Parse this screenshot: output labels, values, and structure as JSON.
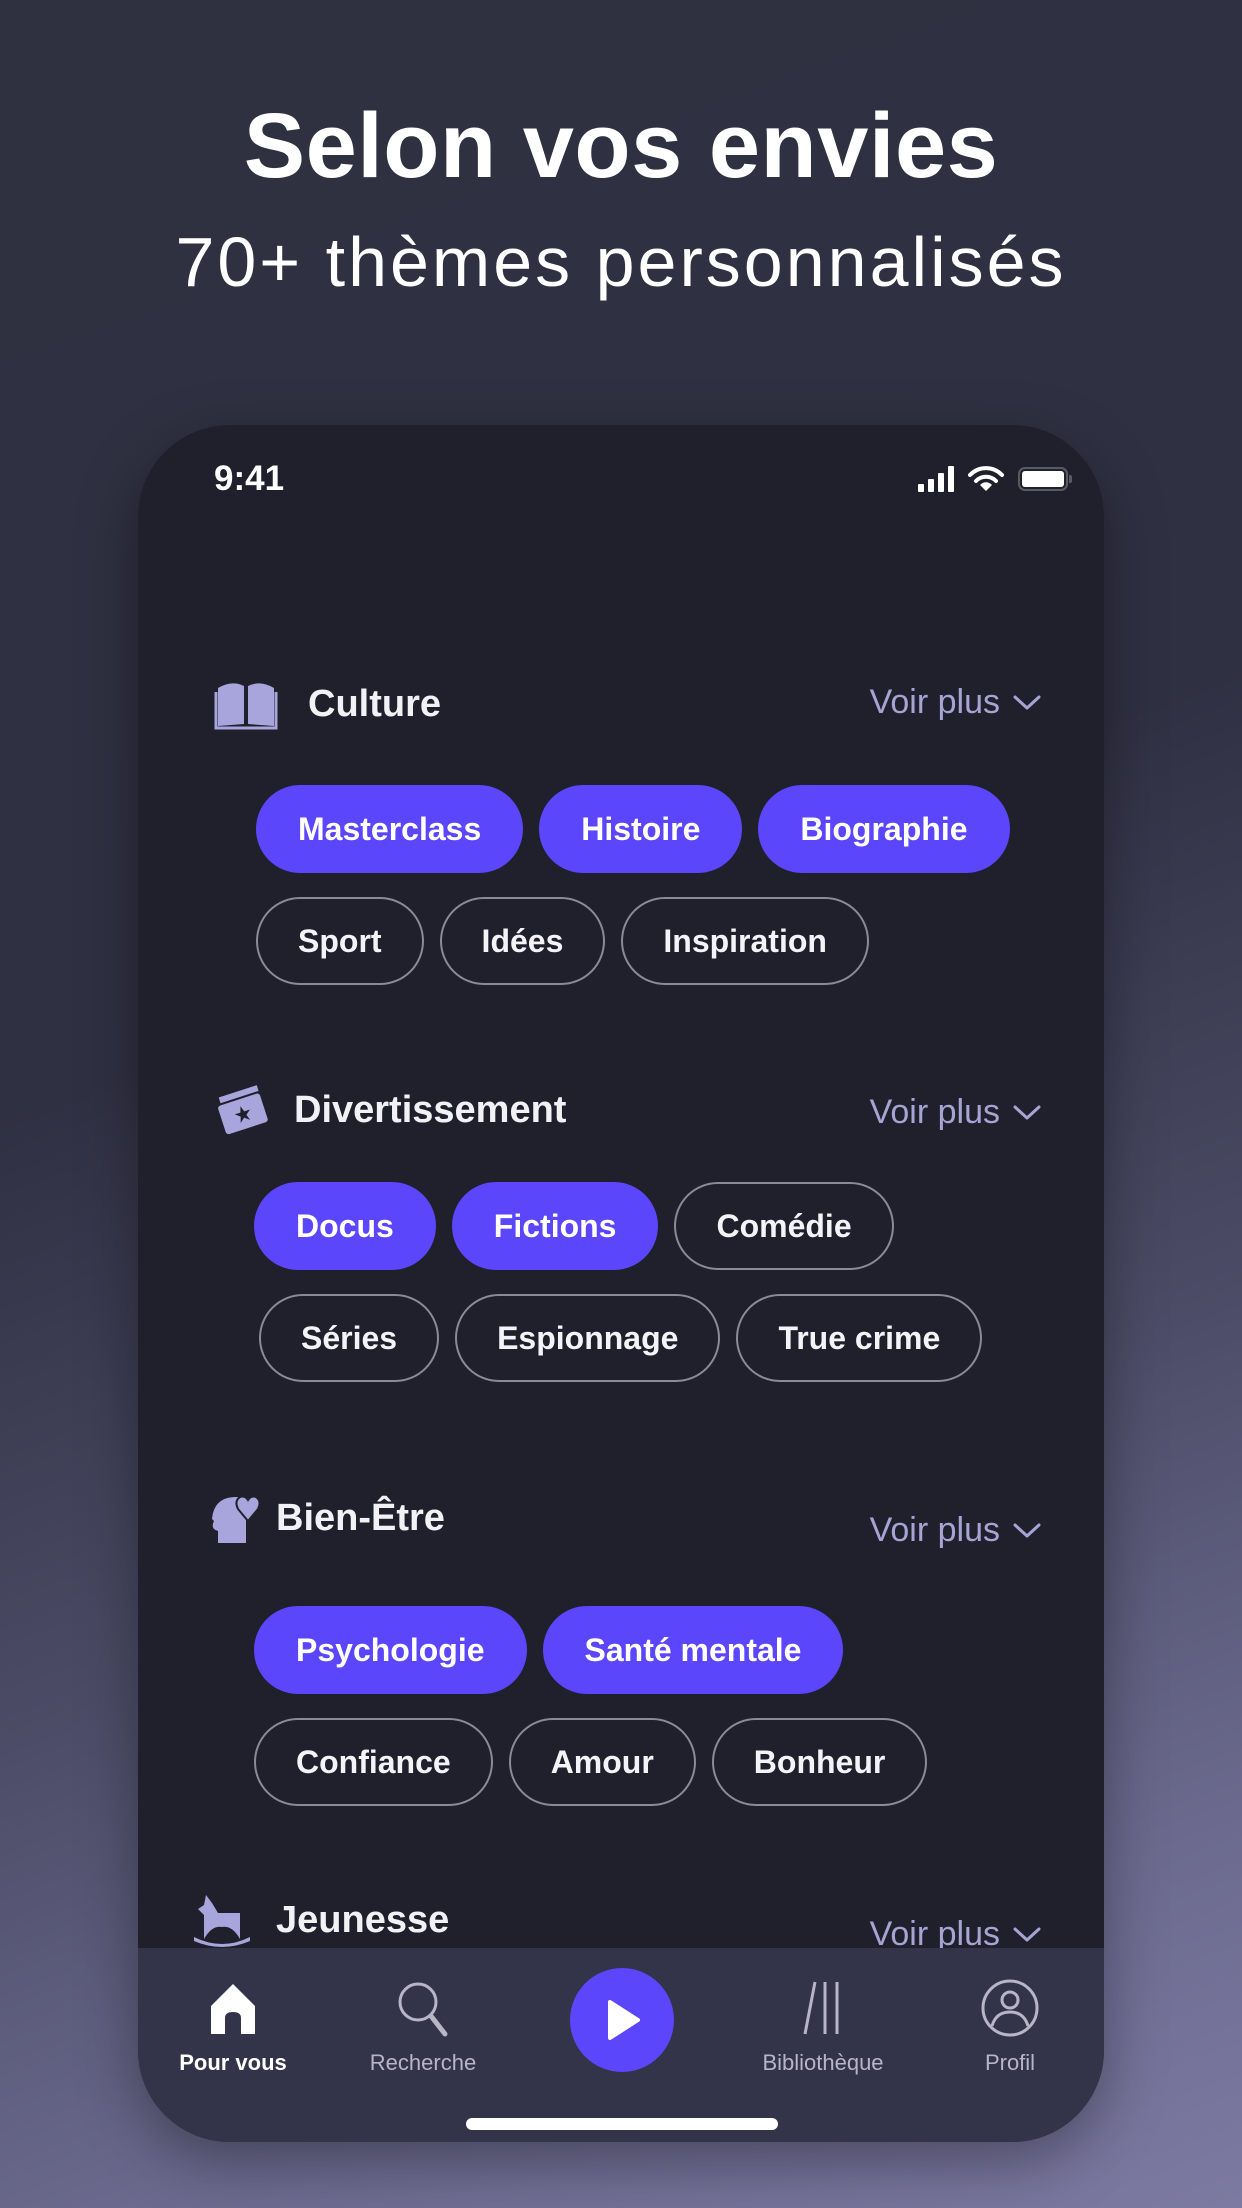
{
  "hero": {
    "title": "Selon vos envies",
    "subtitle": "70+ thèmes personnalisés"
  },
  "status_bar": {
    "time": "9:41",
    "icons": [
      "signal-icon",
      "wifi-icon",
      "battery-icon"
    ]
  },
  "colors": {
    "accent": "#5b46fb",
    "screen_bg": "#20202c",
    "tabbar_bg": "#33334a",
    "icon_lavender": "#a8a5dc",
    "voir_plus": "#a6a4d4"
  },
  "sections": [
    {
      "title": "Culture",
      "icon": "book-icon",
      "more_label": "Voir plus",
      "rows": [
        [
          {
            "label": "Masterclass",
            "selected": true
          },
          {
            "label": "Histoire",
            "selected": true
          },
          {
            "label": "Biographie",
            "selected": true
          }
        ],
        [
          {
            "label": "Sport",
            "selected": false
          },
          {
            "label": "Idées",
            "selected": false
          },
          {
            "label": "Inspiration",
            "selected": false
          }
        ]
      ]
    },
    {
      "title": "Divertissement",
      "icon": "tickets-icon",
      "more_label": "Voir plus",
      "rows": [
        [
          {
            "label": "Docus",
            "selected": true
          },
          {
            "label": "Fictions",
            "selected": true
          },
          {
            "label": "Comédie",
            "selected": false
          }
        ],
        [
          {
            "label": "Séries",
            "selected": false
          },
          {
            "label": "Espionnage",
            "selected": false
          },
          {
            "label": "True crime",
            "selected": false
          }
        ]
      ]
    },
    {
      "title": "Bien-Être",
      "icon": "head-heart-icon",
      "more_label": "Voir plus",
      "rows": [
        [
          {
            "label": "Psychologie",
            "selected": true
          },
          {
            "label": "Santé mentale",
            "selected": true
          }
        ],
        [
          {
            "label": "Confiance",
            "selected": false
          },
          {
            "label": "Amour",
            "selected": false
          },
          {
            "label": "Bonheur",
            "selected": false
          }
        ]
      ]
    },
    {
      "title": "Jeunesse",
      "icon": "rocking-horse-icon",
      "more_label": "Voir plus",
      "rows": []
    }
  ],
  "tabbar": {
    "items": [
      {
        "label": "Pour vous",
        "icon": "home-icon",
        "active": true
      },
      {
        "label": "Recherche",
        "icon": "search-icon",
        "active": false
      },
      {
        "label": "",
        "icon": "play-icon",
        "active": false
      },
      {
        "label": "Bibliothèque",
        "icon": "library-icon",
        "active": false
      },
      {
        "label": "Profil",
        "icon": "profile-icon",
        "active": false
      }
    ]
  }
}
